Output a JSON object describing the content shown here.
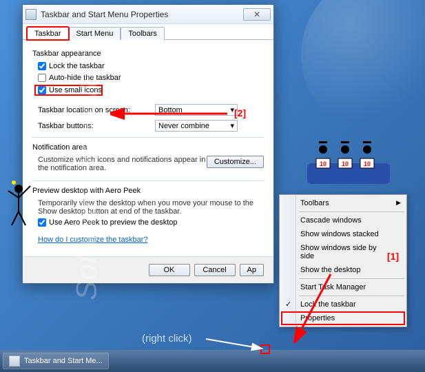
{
  "watermark": "SoftwareOK.com",
  "dialog": {
    "title": "Taskbar and Start Menu Properties",
    "tabs": [
      "Taskbar",
      "Start Menu",
      "Toolbars"
    ],
    "appearance": {
      "label": "Taskbar appearance",
      "lock": "Lock the taskbar",
      "autohide": "Auto-hide the taskbar",
      "smallicons": "Use small icons"
    },
    "location": {
      "label": "Taskbar location on screen:",
      "value": "Bottom"
    },
    "buttons": {
      "label": "Taskbar buttons:",
      "value": "Never combine"
    },
    "notification": {
      "label": "Notification area",
      "desc": "Customize which icons and notifications appear in the notification area.",
      "btn": "Customize..."
    },
    "aero": {
      "label": "Preview desktop with Aero Peek",
      "desc": "Temporarily view the desktop when you move your mouse to the Show desktop button at end of the taskbar.",
      "check": "Use Aero Peek to preview the desktop"
    },
    "help": "How do I customize the taskbar?",
    "ok": "OK",
    "cancel": "Cancel",
    "apply": "Ap"
  },
  "context_menu": {
    "toolbars": "Toolbars",
    "cascade": "Cascade windows",
    "stacked": "Show windows stacked",
    "sidebyside": "Show windows side by side",
    "showdesktop": "Show the desktop",
    "taskmgr": "Start Task Manager",
    "lock": "Lock the taskbar",
    "properties": "Properties"
  },
  "annotations": {
    "label1": "[1]",
    "label2": "[2]",
    "rightclick": "(right click)"
  },
  "taskbar": {
    "item": "Taskbar and Start Me..."
  }
}
